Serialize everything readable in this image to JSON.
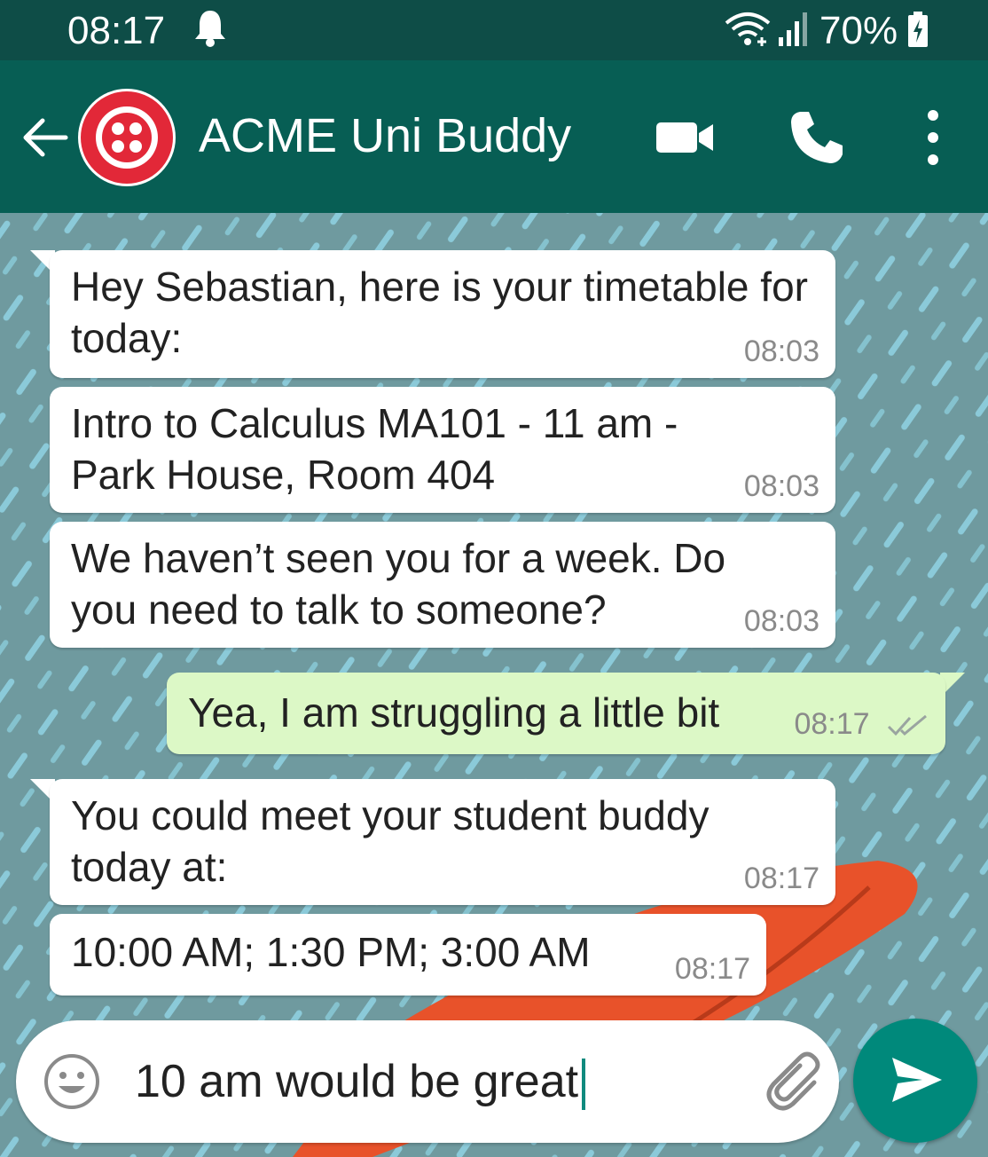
{
  "status_bar": {
    "time": "08:17",
    "battery": "70%",
    "icons": [
      "bell-icon",
      "wifi-icon",
      "signal-icon",
      "battery-icon"
    ]
  },
  "header": {
    "contact_name": "ACME Uni Buddy",
    "icons": [
      "back-arrow-icon",
      "video-call-icon",
      "phone-icon",
      "more-vertical-icon"
    ]
  },
  "messages": [
    {
      "direction": "in",
      "text": "Hey Sebastian, here is your timetable for today:",
      "time": "08:03"
    },
    {
      "direction": "in",
      "text": "Intro to Calculus MA101 - 11 am - Park House, Room 404",
      "time": "08:03"
    },
    {
      "direction": "in",
      "text": "We haven’t seen you for a week. Do you need to talk to someone?",
      "time": "08:03"
    },
    {
      "direction": "out",
      "text": "Yea, I am struggling a little bit",
      "time": "08:17",
      "status": "read"
    },
    {
      "direction": "in",
      "text": "You could meet your student buddy today at:",
      "time": "08:17"
    },
    {
      "direction": "in",
      "text": "10:00 AM; 1:30 PM; 3:00 AM",
      "time": "08:17"
    }
  ],
  "composer": {
    "value": "10 am would be great",
    "icons": [
      "emoji-icon",
      "attach-icon",
      "send-icon"
    ]
  },
  "colors": {
    "status_bar": "#0e4d47",
    "app_bar": "#075e54",
    "outgoing_bubble": "#dcf8c6",
    "send_button": "#00897b",
    "read_ticks": "#8a8a8a"
  }
}
